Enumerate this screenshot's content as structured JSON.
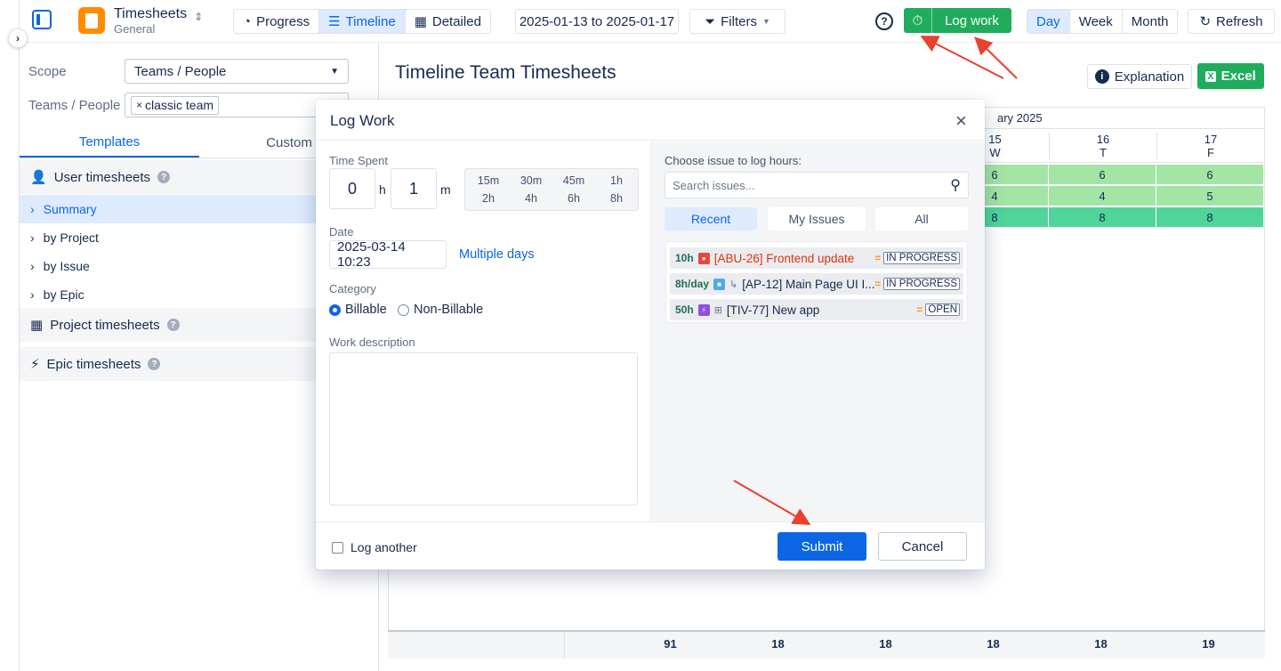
{
  "topbar": {
    "app_title": "Timesheets",
    "app_subtitle": "General",
    "view_tabs": [
      "Progress",
      "Timeline",
      "Detailed"
    ],
    "active_view": "Timeline",
    "date_range": "2025-01-13 to 2025-01-17",
    "filters_label": "Filters",
    "help_label": "?",
    "log_work_label": "Log work",
    "period_tabs": [
      "Day",
      "Week",
      "Month"
    ],
    "active_period": "Day",
    "refresh_label": "Refresh"
  },
  "sidebar": {
    "scope_label": "Scope",
    "scope_value": "Teams / People",
    "teams_label": "Teams / People",
    "team_tag": "classic team",
    "tabs": [
      "Templates",
      "Custom"
    ],
    "user_group": "User timesheets",
    "items": [
      "Summary",
      "by Project",
      "by Issue",
      "by Epic"
    ],
    "project_group": "Project timesheets",
    "epic_group": "Epic timesheets"
  },
  "main": {
    "title": "Timeline Team Timesheets",
    "explanation_label": "Explanation",
    "excel_label": "Excel",
    "month_header": "ary 2025",
    "days": [
      {
        "num": "15",
        "dow": "W",
        "values": [
          "6",
          "4",
          "8"
        ]
      },
      {
        "num": "16",
        "dow": "T",
        "values": [
          "6",
          "4",
          "8"
        ]
      },
      {
        "num": "17",
        "dow": "F",
        "values": [
          "6",
          "5",
          "8"
        ]
      }
    ],
    "totals": [
      "91",
      "18",
      "18",
      "18",
      "18",
      "19"
    ]
  },
  "modal": {
    "title": "Log Work",
    "close_label": "×",
    "time_spent_label": "Time Spent",
    "hours_value": "0",
    "hours_unit": "h",
    "minutes_value": "1",
    "minutes_unit": "m",
    "presets": [
      "15m",
      "30m",
      "45m",
      "1h",
      "2h",
      "4h",
      "6h",
      "8h"
    ],
    "date_label": "Date",
    "date_value": "2025-03-14 10:23",
    "multiple_days_label": "Multiple days",
    "category_label": "Category",
    "billable_label": "Billable",
    "non_billable_label": "Non-Billable",
    "description_label": "Work description",
    "choose_issue_label": "Choose issue to log hours:",
    "search_placeholder": "Search issues...",
    "issue_tabs": [
      "Recent",
      "My Issues",
      "All"
    ],
    "issues": [
      {
        "hours": "10h",
        "text": "[ABU-26] Frontend update",
        "status": "IN PROGRESS"
      },
      {
        "hours": "8h/day",
        "text": "[AP-12] Main Page UI I...",
        "status": "IN PROGRESS"
      },
      {
        "hours": "50h",
        "text": "[TIV-77] New app",
        "status": "OPEN"
      }
    ],
    "log_another_label": "Log another",
    "submit_label": "Submit",
    "cancel_label": "Cancel"
  },
  "colors": {
    "accent": "#0c66e4",
    "success": "#1fad5d",
    "cell_light": "#a3e5a5",
    "cell_medium": "#4fd49a",
    "annotation_arrow": "#e8412c"
  }
}
